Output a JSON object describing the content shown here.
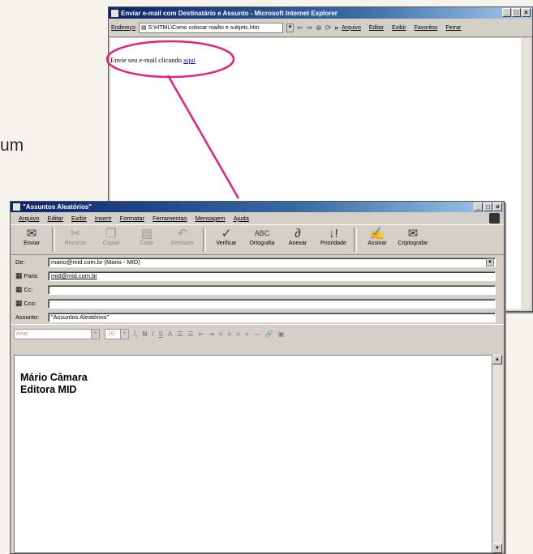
{
  "page": {
    "partial_text": "um"
  },
  "ie": {
    "title": "Enviar e-mail com Destinatário e Assunto - Microsoft Internet Explorer",
    "address_label": "Endereço",
    "address_value": "S:\\HTML\\Como colocar mailto e subjetc.htm",
    "menu": [
      "Arquivo",
      "Editar",
      "Exibir",
      "Favoritos",
      "Ferrar"
    ],
    "body_text": "Envie seu e-mail clicando ",
    "link_text": "aqui"
  },
  "oe": {
    "title": "\"Assuntos Aleatórios\"",
    "menu": [
      "Arquivo",
      "Editar",
      "Exibir",
      "Inserir",
      "Formatar",
      "Ferramentas",
      "Mensagem",
      "Ajuda"
    ],
    "toolbar": [
      {
        "label": "Enviar",
        "icon": "send-icon",
        "glyph": "✉"
      },
      {
        "label": "Recortar",
        "icon": "cut-icon",
        "glyph": "✂"
      },
      {
        "label": "Copiar",
        "icon": "copy-icon",
        "glyph": "❐"
      },
      {
        "label": "Colar",
        "icon": "paste-icon",
        "glyph": "📋"
      },
      {
        "label": "Desfazer",
        "icon": "undo-icon",
        "glyph": "↶"
      },
      {
        "label": "Verificar",
        "icon": "check-names-icon",
        "glyph": "✓"
      },
      {
        "label": "Ortografia",
        "icon": "spelling-icon",
        "glyph": "ABC"
      },
      {
        "label": "Anexar",
        "icon": "attach-icon",
        "glyph": "📎"
      },
      {
        "label": "Prioridade",
        "icon": "priority-icon",
        "glyph": "!"
      },
      {
        "label": "Assinar",
        "icon": "sign-icon",
        "glyph": "✍"
      },
      {
        "label": "Criptografar",
        "icon": "encrypt-icon",
        "glyph": "🔒"
      }
    ],
    "from_label": "De:",
    "from_value": "mario@mid.com.br   (Mario - MID)",
    "to_label": "Para:",
    "to_value": "mid@mid.com.br",
    "cc_label": "Cc:",
    "cc_value": "",
    "bcc_label": "Cco:",
    "bcc_value": "",
    "subject_label": "Assunto:",
    "subject_value": "\"Assuntos Aleatórios\"",
    "font_name": "Arial",
    "font_size": "10",
    "signature_line1": "Mário Câmara",
    "signature_line2": "Editora MID"
  },
  "colors": {
    "annotation": "#e8207a",
    "titlebar": "#0a246a",
    "link": "#0000cc"
  }
}
